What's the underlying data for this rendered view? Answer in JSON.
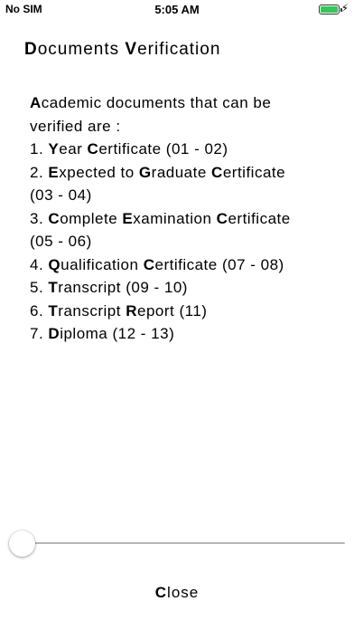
{
  "status_bar": {
    "carrier": "No SIM",
    "time": "5:05 AM",
    "battery_level": 1.0,
    "battery_color": "#34c759",
    "bolt": "⚡"
  },
  "header": {
    "title_parts": [
      {
        "t": "D",
        "b": true
      },
      {
        "t": "ocuments ",
        "b": false
      },
      {
        "t": "V",
        "b": true
      },
      {
        "t": "erification",
        "b": false
      }
    ]
  },
  "content": {
    "lines": [
      [
        {
          "t": "A",
          "b": true
        },
        {
          "t": "cademic documents that can be",
          "b": false
        }
      ],
      [
        {
          "t": "verified are :",
          "b": false
        }
      ],
      [
        {
          "t": "1. ",
          "b": false
        },
        {
          "t": "Y",
          "b": true
        },
        {
          "t": "ear ",
          "b": false
        },
        {
          "t": "C",
          "b": true
        },
        {
          "t": "ertificate (01 - 02)",
          "b": false
        }
      ],
      [
        {
          "t": "2. ",
          "b": false
        },
        {
          "t": "E",
          "b": true
        },
        {
          "t": "xpected to ",
          "b": false
        },
        {
          "t": "G",
          "b": true
        },
        {
          "t": "raduate ",
          "b": false
        },
        {
          "t": "C",
          "b": true
        },
        {
          "t": "ertificate",
          "b": false
        }
      ],
      [
        {
          "t": "(03 - 04)",
          "b": false
        }
      ],
      [
        {
          "t": "3. ",
          "b": false
        },
        {
          "t": "C",
          "b": true
        },
        {
          "t": "omplete ",
          "b": false
        },
        {
          "t": "E",
          "b": true
        },
        {
          "t": "xamination ",
          "b": false
        },
        {
          "t": "C",
          "b": true
        },
        {
          "t": "ertificate",
          "b": false
        }
      ],
      [
        {
          "t": "(05 - 06)",
          "b": false
        }
      ],
      [
        {
          "t": "4. ",
          "b": false
        },
        {
          "t": "Q",
          "b": true
        },
        {
          "t": "ualification ",
          "b": false
        },
        {
          "t": "C",
          "b": true
        },
        {
          "t": "ertificate (07 - 08)",
          "b": false
        }
      ],
      [
        {
          "t": "5. ",
          "b": false
        },
        {
          "t": "T",
          "b": true
        },
        {
          "t": "ranscript (09 - 10)",
          "b": false
        }
      ],
      [
        {
          "t": "6. ",
          "b": false
        },
        {
          "t": "T",
          "b": true
        },
        {
          "t": "ranscript ",
          "b": false
        },
        {
          "t": "R",
          "b": true
        },
        {
          "t": "eport (11)",
          "b": false
        }
      ],
      [
        {
          "t": "7. ",
          "b": false
        },
        {
          "t": "D",
          "b": true
        },
        {
          "t": "iploma (12 - 13)",
          "b": false
        }
      ]
    ]
  },
  "slider": {
    "value": 0.0
  },
  "footer": {
    "close_parts": [
      {
        "t": "C",
        "b": true
      },
      {
        "t": "lose",
        "b": false
      }
    ]
  }
}
